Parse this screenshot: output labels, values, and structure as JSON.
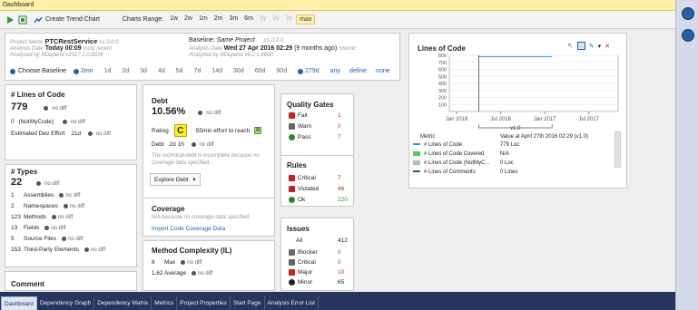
{
  "window": {
    "title": "Dashboard"
  },
  "toolbar": {
    "create_trend_label": "Create Trend Chart",
    "charts_range_label": "Charts Range:",
    "range_options": [
      "1w",
      "2w",
      "1m",
      "2m",
      "3m",
      "6m",
      "1y",
      "2y",
      "3y",
      "max"
    ],
    "range_selected": "max"
  },
  "project": {
    "name_label": "Project Name",
    "name": "PTCRestService",
    "version": "v1.0.0.0",
    "analysis_date_label": "Analysis Date",
    "analysis_date": "Today 00:09",
    "analysis_date_note": "most recent",
    "analyzed_by": "Analyzed by NDepend v2017.1.0.0016"
  },
  "baseline": {
    "label": "Baseline:",
    "project": "Same Project",
    "version": "v1.0.0.0",
    "analysis_date_label": "Analysis Date",
    "analysis_date": "Wed 27 Apr 2016 02:29",
    "analysis_date_note": "(9 months ago)",
    "historic": "historic",
    "analyzed_by": "Analyzed by NDepend v6.2.1.8600",
    "choose_label": "Choose Baseline",
    "options": [
      "2mn",
      "1d",
      "2d",
      "3d",
      "4d",
      "5d",
      "7d",
      "14d",
      "30d",
      "60d",
      "90d",
      "279d",
      "any",
      "define",
      "none"
    ],
    "selected": "279d"
  },
  "loc": {
    "title": "# Lines of Code",
    "value": "779",
    "not_my_code_value": "0",
    "not_my_code_label": "(NotMyCode)",
    "effort_label": "Estimated Dev Effort",
    "effort_value": "21d",
    "no_diff": "no diff"
  },
  "debt": {
    "title": "Debt",
    "percent": "10.56%",
    "rating_label": "Rating",
    "rating": "C",
    "effort_text": "55min effort to reach",
    "target_rating": "B",
    "debt_label": "Debt",
    "debt_value": "2d  1h",
    "note": "The technical-debt is incomplete because no coverage data specified.",
    "explore_label": "Explore Debt",
    "no_diff": "no diff"
  },
  "types": {
    "title": "# Types",
    "value": "22",
    "rows": [
      {
        "count": "1",
        "label": "Assemblies"
      },
      {
        "count": "2",
        "label": "Namespaces"
      },
      {
        "count": "123",
        "label": "Methods"
      },
      {
        "count": "13",
        "label": "Fields"
      },
      {
        "count": "5",
        "label": "Source Files"
      },
      {
        "count": "153",
        "label": "Third-Party Elements"
      }
    ],
    "no_diff": "no diff"
  },
  "coverage": {
    "title": "Coverage",
    "note": "N/A because no coverage data specified",
    "link": "Import Code Coverage Data"
  },
  "complexity": {
    "title": "Method Complexity (IL)",
    "rows": [
      {
        "value": "8",
        "label": "Max"
      },
      {
        "value": "1.62",
        "label": "Average"
      }
    ],
    "no_diff": "no diff"
  },
  "comment": {
    "title": "Comment"
  },
  "quality_gates": {
    "title": "Quality Gates",
    "rows": [
      {
        "label": "Fail",
        "value": "1",
        "color": "#cc1f1f"
      },
      {
        "label": "Warn",
        "value": "0",
        "color": "#666666"
      },
      {
        "label": "Pass",
        "value": "7",
        "color": "#2a8a2a"
      }
    ]
  },
  "rules": {
    "title": "Rules",
    "rows": [
      {
        "label": "Critical",
        "value": "7",
        "color": "#cc1f1f"
      },
      {
        "label": "Violated",
        "value": "46",
        "color": "#cc1f1f"
      },
      {
        "label": "Ok",
        "value": "220",
        "color": "#2a8a2a"
      }
    ]
  },
  "issues": {
    "title": "Issues",
    "all_label": "All",
    "all_value": "412",
    "rows": [
      {
        "label": "Blocker",
        "value": "0",
        "color": "#666666"
      },
      {
        "label": "Critical",
        "value": "0",
        "color": "#666666"
      },
      {
        "label": "Major",
        "value": "10",
        "color": "#cc1f1f"
      },
      {
        "label": "Minor",
        "value": "65",
        "color": "#222222"
      }
    ]
  },
  "trend": {
    "title": "Lines of Code",
    "version_marker": "v1.0",
    "table_header_metric": "Metric",
    "table_header_value": "Value at April 27th 2016  02:29  (v1.0)",
    "rows": [
      {
        "label": "# Lines of Code",
        "value": "779 Loc",
        "color": "#2d9fe0"
      },
      {
        "label": "# Lines of Code Covered",
        "value": "N/A",
        "color": "#5cc85c"
      },
      {
        "label": "# Lines of Code (NotMyC...",
        "value": "0 Loc",
        "color": "#b9b9b9"
      },
      {
        "label": "# Lines of Comments",
        "value": "0 Lines",
        "color": "#1a7a1a"
      }
    ]
  },
  "chart_data": {
    "type": "line",
    "title": "Lines of Code",
    "x_tick_labels": [
      "Jan 2016",
      "Jul 2016",
      "Jan 2017",
      "Jul 2017"
    ],
    "y_tick_labels": [
      "100",
      "200",
      "300",
      "400",
      "500",
      "600",
      "700",
      "800"
    ],
    "ylim": [
      0,
      800
    ],
    "series": [
      {
        "name": "# Lines of Code",
        "color": "#2d9fe0",
        "points": [
          [
            "Apr 2016",
            779
          ],
          [
            "Feb 2017",
            779
          ]
        ]
      }
    ]
  },
  "tabs": [
    "Dashboard",
    "Dependency Graph",
    "Dependency Matrix",
    "Metrics",
    "Project Properties",
    "Start Page",
    "Analysis Error List"
  ],
  "active_tab": "Dashboard"
}
